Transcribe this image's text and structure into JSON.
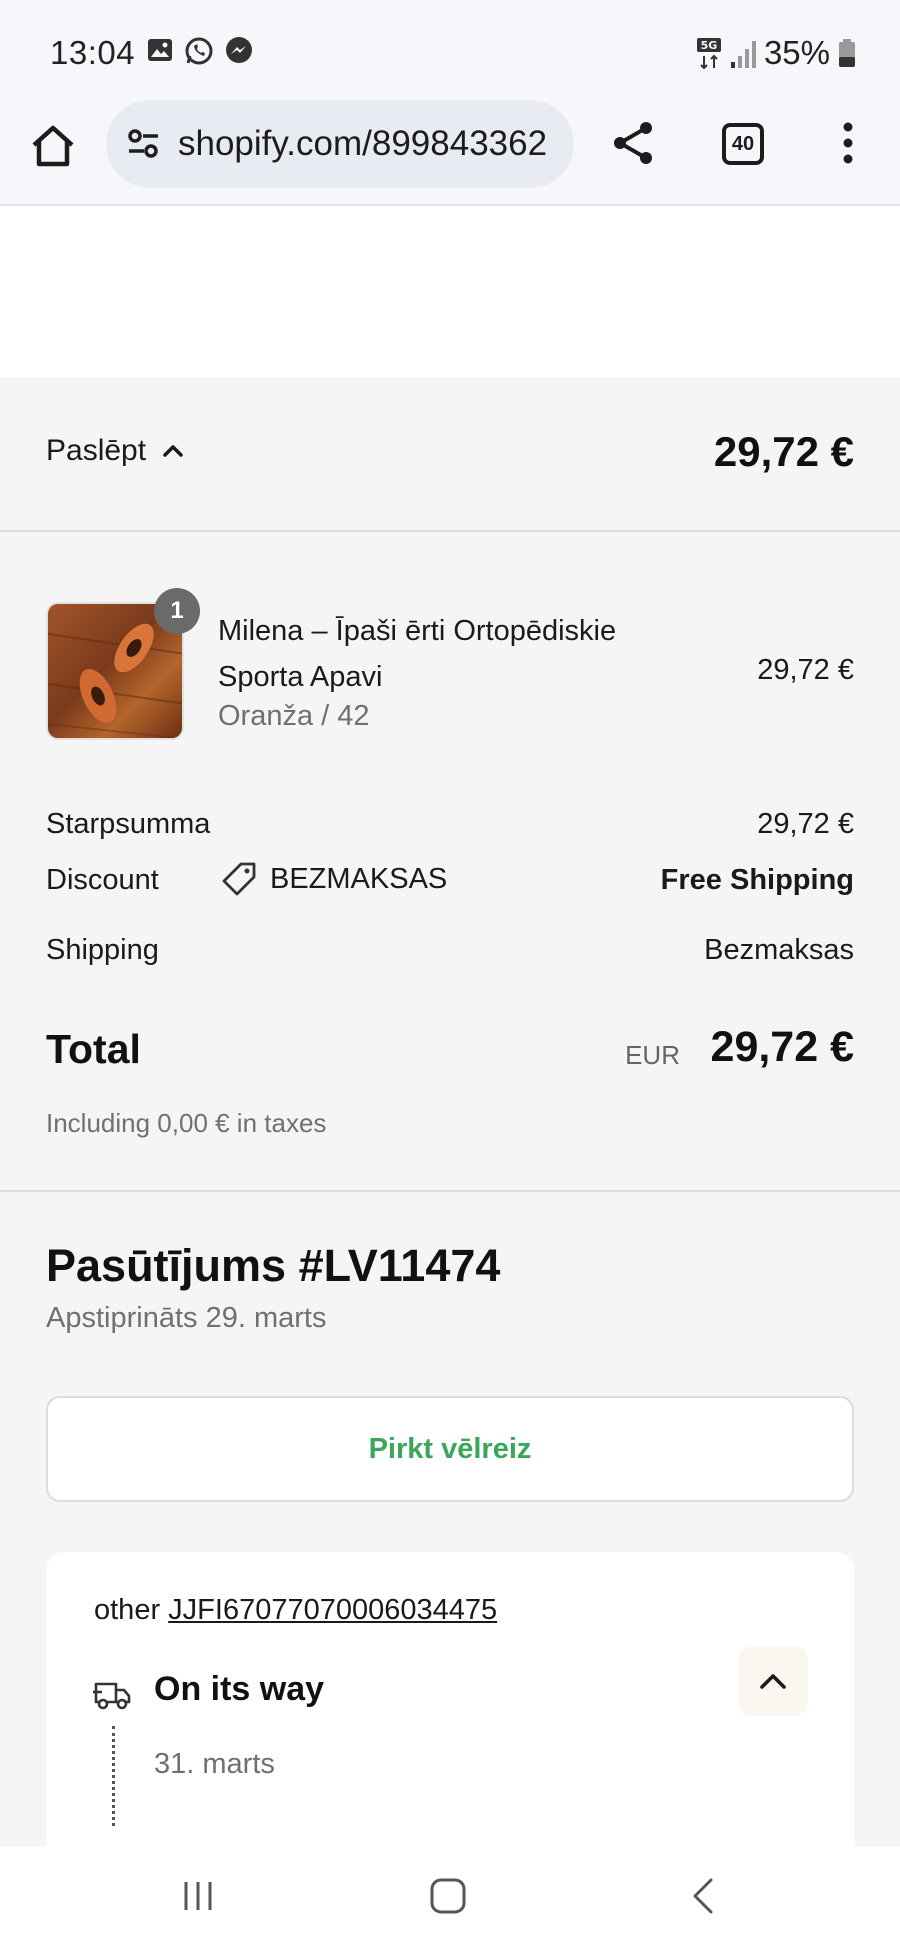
{
  "status_bar": {
    "time": "13:04",
    "battery": "35%",
    "network": "5G",
    "notification_icons": [
      "gallery-icon",
      "whatsapp-icon",
      "messenger-icon"
    ]
  },
  "browser": {
    "url": "shopify.com/899843362",
    "tab_count": "40"
  },
  "summary": {
    "toggle_label": "Paslēpt",
    "header_total": "29,72 €",
    "product": {
      "name": "Milena – Īpaši ērti Ortopēdiskie Sporta Apavi",
      "variant": "Oranža / 42",
      "price": "29,72 €",
      "quantity": "1"
    },
    "subtotal_label": "Starpsumma",
    "subtotal_value": "29,72 €",
    "discount_label": "Discount",
    "discount_code": "BEZMAKSAS",
    "discount_value": "Free Shipping",
    "shipping_label": "Shipping",
    "shipping_value": "Bezmaksas",
    "total_label": "Total",
    "total_currency": "EUR",
    "total_value": "29,72 €",
    "taxes_note": "Including 0,00 € in taxes"
  },
  "order": {
    "title": "Pasūtījums #LV11474",
    "confirmed": "Apstiprināts 29. marts",
    "buy_again": "Pirkt vēlreiz"
  },
  "tracking": {
    "carrier": "other",
    "number": "JJFI67077070006034475",
    "status": "On its way",
    "event_date": "31. marts"
  },
  "colors": {
    "accent_green": "#3aa65a",
    "summary_bg": "#f5f5f5"
  }
}
